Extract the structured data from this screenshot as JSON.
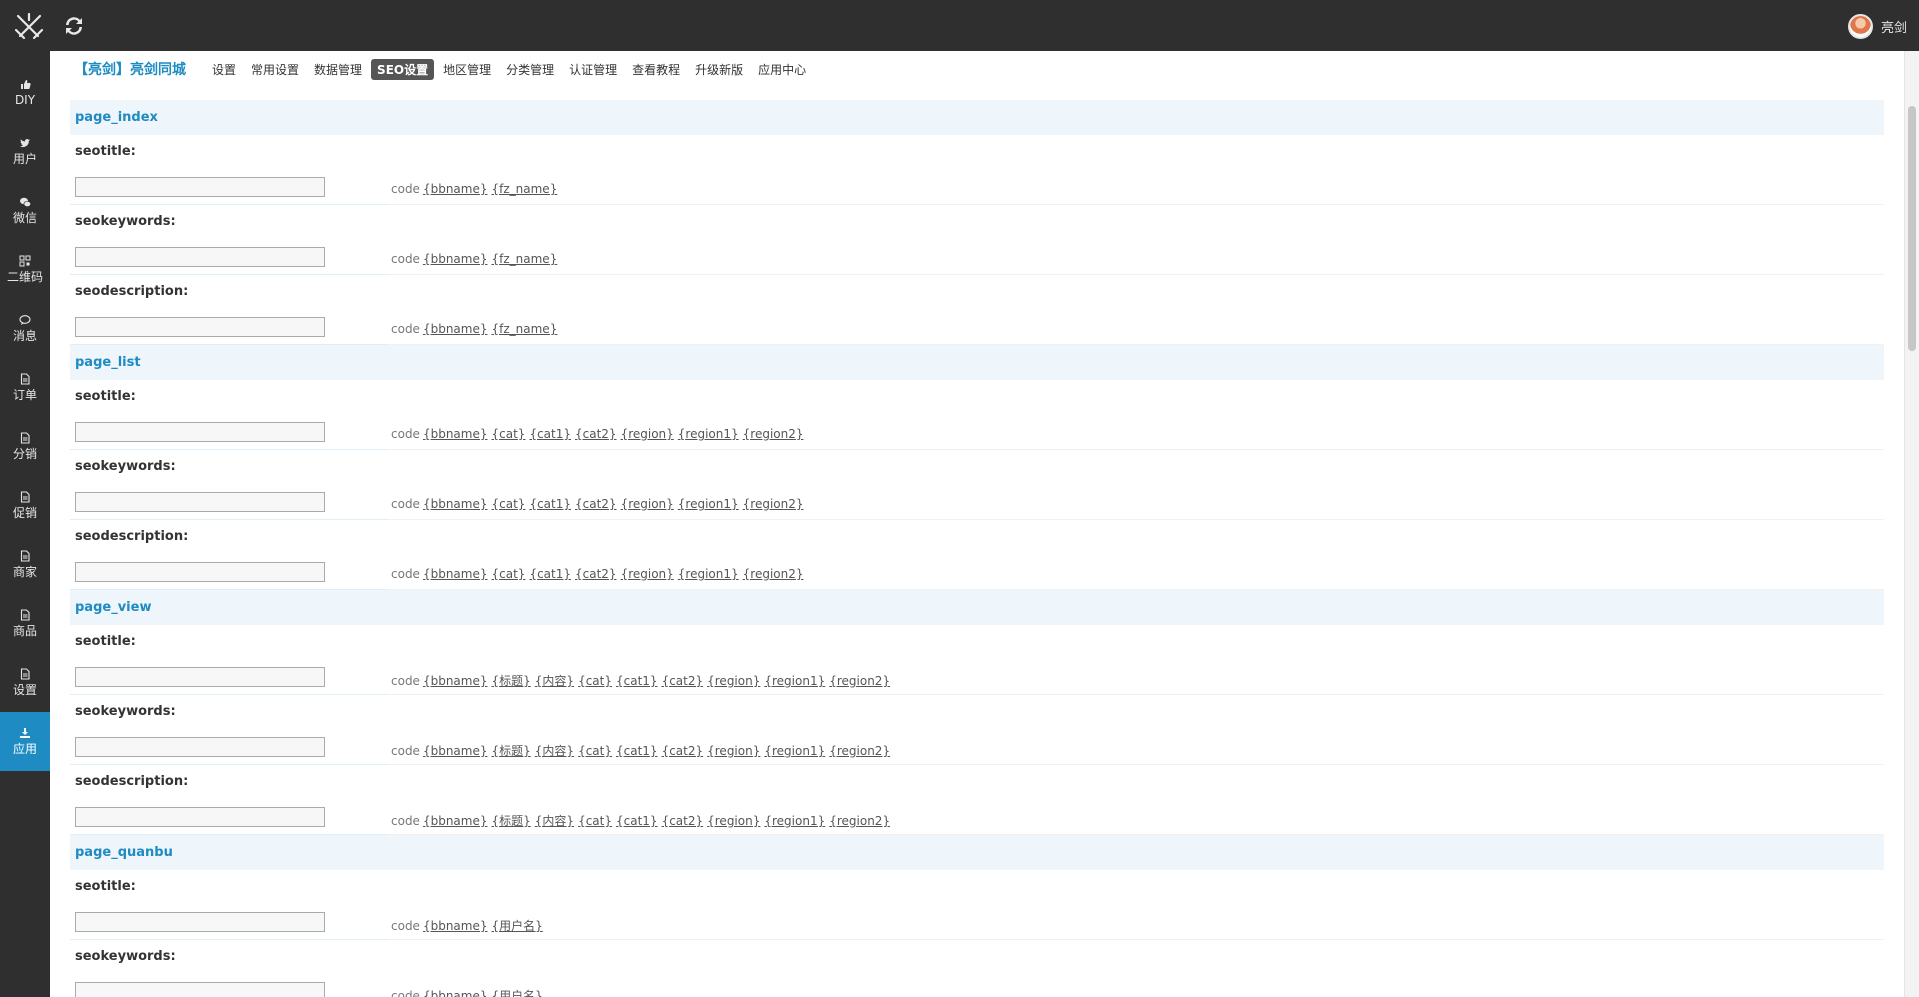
{
  "topbar": {
    "username": "亮剑"
  },
  "sidebar": {
    "items": [
      {
        "label": "DIY",
        "icon": "thumbs-up-icon"
      },
      {
        "label": "用户",
        "icon": "twitter-icon"
      },
      {
        "label": "微信",
        "icon": "wechat-icon"
      },
      {
        "label": "二维码",
        "icon": "qrcode-icon"
      },
      {
        "label": "消息",
        "icon": "comment-icon"
      },
      {
        "label": "订单",
        "icon": "document-icon"
      },
      {
        "label": "分销",
        "icon": "document-icon"
      },
      {
        "label": "促销",
        "icon": "document-icon"
      },
      {
        "label": "商家",
        "icon": "document-icon"
      },
      {
        "label": "商品",
        "icon": "document-icon"
      },
      {
        "label": "设置",
        "icon": "document-icon"
      },
      {
        "label": "应用",
        "icon": "download-icon",
        "active": true
      }
    ]
  },
  "nav": {
    "site_title": "【亮剑】亮剑同城",
    "tabs": [
      "设置",
      "常用设置",
      "数据管理",
      "SEO设置",
      "地区管理",
      "分类管理",
      "认证管理",
      "查看教程",
      "升级新版",
      "应用中心"
    ],
    "active_tab": "SEO设置"
  },
  "code_prefix": "code",
  "sections": [
    {
      "title": "page_index",
      "fields": [
        {
          "label": "seotitle:",
          "value": "",
          "codes": [
            "{bbname}",
            "{fz_name}"
          ]
        },
        {
          "label": "seokeywords:",
          "value": "",
          "codes": [
            "{bbname}",
            "{fz_name}"
          ]
        },
        {
          "label": "seodescription:",
          "value": "",
          "codes": [
            "{bbname}",
            "{fz_name}"
          ]
        }
      ]
    },
    {
      "title": "page_list",
      "fields": [
        {
          "label": "seotitle:",
          "value": "",
          "codes": [
            "{bbname}",
            "{cat}",
            "{cat1}",
            "{cat2}",
            "{region}",
            "{region1}",
            "{region2}"
          ]
        },
        {
          "label": "seokeywords:",
          "value": "",
          "codes": [
            "{bbname}",
            "{cat}",
            "{cat1}",
            "{cat2}",
            "{region}",
            "{region1}",
            "{region2}"
          ]
        },
        {
          "label": "seodescription:",
          "value": "",
          "codes": [
            "{bbname}",
            "{cat}",
            "{cat1}",
            "{cat2}",
            "{region}",
            "{region1}",
            "{region2}"
          ]
        }
      ]
    },
    {
      "title": "page_view",
      "fields": [
        {
          "label": "seotitle:",
          "value": "",
          "codes": [
            "{bbname}",
            "{标题}",
            "{内容}",
            "{cat}",
            "{cat1}",
            "{cat2}",
            "{region}",
            "{region1}",
            "{region2}"
          ]
        },
        {
          "label": "seokeywords:",
          "value": "",
          "codes": [
            "{bbname}",
            "{标题}",
            "{内容}",
            "{cat}",
            "{cat1}",
            "{cat2}",
            "{region}",
            "{region1}",
            "{region2}"
          ]
        },
        {
          "label": "seodescription:",
          "value": "",
          "codes": [
            "{bbname}",
            "{标题}",
            "{内容}",
            "{cat}",
            "{cat1}",
            "{cat2}",
            "{region}",
            "{region1}",
            "{region2}"
          ]
        }
      ]
    },
    {
      "title": "page_quanbu",
      "fields": [
        {
          "label": "seotitle:",
          "value": "",
          "codes": [
            "{bbname}",
            "{用户名}"
          ]
        },
        {
          "label": "seokeywords:",
          "value": "",
          "codes": [
            "{bbname}",
            "{用户名}"
          ]
        }
      ]
    }
  ]
}
